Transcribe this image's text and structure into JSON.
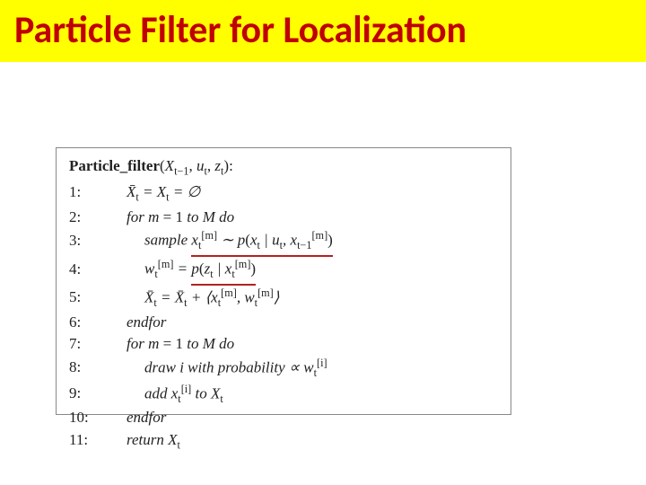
{
  "title": "Particle Filter for Localization",
  "algorithm": {
    "name": "Particle_filter",
    "args_html": "(𝒳_{t−1}, u_t, z_t):",
    "lines": [
      {
        "n": "1:",
        "html": "𝒳̄_t = 𝒳_t = ∅"
      },
      {
        "n": "2:",
        "html": "for m = 1 to M do"
      },
      {
        "n": "3:",
        "html": "sample x_t^[m] ∼ p(x_t | u_t, x_{t−1}^[m])"
      },
      {
        "n": "4:",
        "html": "w_t^[m] = p(z_t | x_t^[m])"
      },
      {
        "n": "5:",
        "html": "𝒳̄_t = 𝒳̄_t + ⟨x_t^[m], w_t^[m]⟩"
      },
      {
        "n": "6:",
        "html": "endfor"
      },
      {
        "n": "7:",
        "html": "for m = 1 to M do"
      },
      {
        "n": "8:",
        "html": "draw i with probability ∝ w_t^[i]"
      },
      {
        "n": "9:",
        "html": "add x_t^[i] to 𝒳_t"
      },
      {
        "n": "10:",
        "html": "endfor"
      },
      {
        "n": "11:",
        "html": "return 𝒳_t"
      }
    ]
  }
}
